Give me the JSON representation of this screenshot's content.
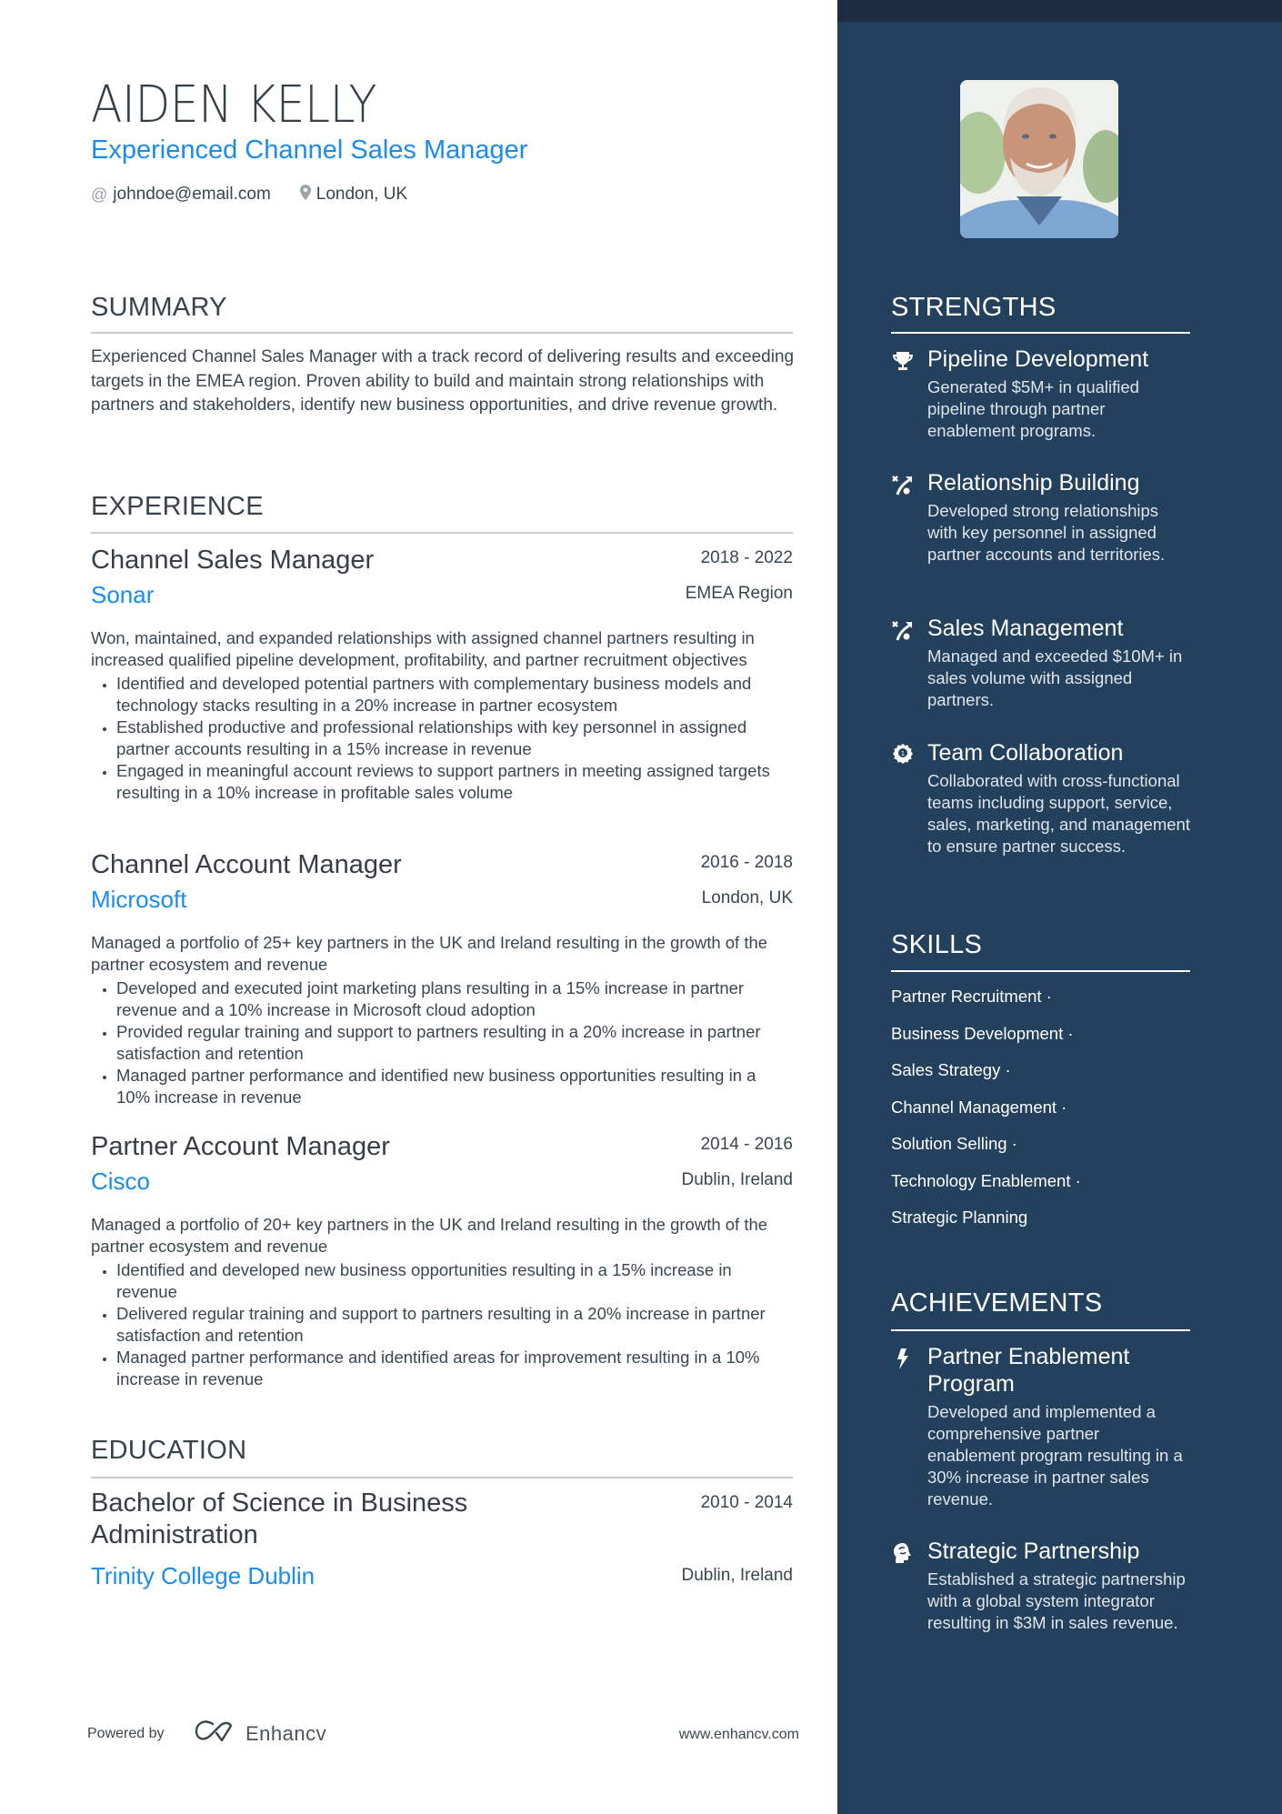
{
  "header": {
    "name": "AIDEN KELLY",
    "headline": "Experienced Channel Sales Manager",
    "email": "johndoe@email.com",
    "email_icon": "at-icon",
    "location": "London, UK",
    "location_icon": "map-pin-icon"
  },
  "summary": {
    "heading": "SUMMARY",
    "text": "Experienced Channel Sales Manager with a track record of delivering results and exceeding targets in the EMEA region. Proven ability to build and maintain strong relationships with partners and stakeholders, identify new business opportunities, and drive revenue growth."
  },
  "experience": {
    "heading": "EXPERIENCE",
    "jobs": [
      {
        "title": "Channel Sales Manager",
        "dates": "2018 - 2022",
        "company": "Sonar",
        "location": "EMEA Region",
        "description": "Won, maintained, and expanded relationships with assigned channel partners resulting in increased qualified pipeline development, profitability, and partner recruitment objectives",
        "bullets": [
          "Identified and developed potential partners with complementary business models and technology stacks resulting in a 20% increase in partner ecosystem",
          "Established productive and professional relationships with key personnel in assigned partner accounts resulting in a 15% increase in revenue",
          "Engaged in meaningful account reviews to support partners in meeting assigned targets resulting in a 10% increase in profitable sales volume"
        ]
      },
      {
        "title": "Channel Account Manager",
        "dates": "2016 - 2018",
        "company": "Microsoft",
        "location": "London, UK",
        "description": "Managed a portfolio of 25+ key partners in the UK and Ireland resulting in the growth of the partner ecosystem and revenue",
        "bullets": [
          "Developed and executed joint marketing plans resulting in a 15% increase in partner revenue and a 10% increase in Microsoft cloud adoption",
          "Provided regular training and support to partners resulting in a 20% increase in partner satisfaction and retention",
          "Managed partner performance and identified new business opportunities resulting in a 10% increase in revenue"
        ]
      },
      {
        "title": "Partner Account Manager",
        "dates": "2014 - 2016",
        "company": "Cisco",
        "location": "Dublin, Ireland",
        "description": "Managed a portfolio of 20+ key partners in the UK and Ireland resulting in the growth of the partner ecosystem and revenue",
        "bullets": [
          "Identified and developed new business opportunities resulting in a 15% increase in revenue",
          "Delivered regular training and support to partners resulting in a 20% increase in partner satisfaction and retention",
          "Managed partner performance and identified areas for improvement resulting in a 10% increase in revenue"
        ]
      }
    ]
  },
  "education": {
    "heading": "EDUCATION",
    "degree": "Bachelor of Science in Business Administration",
    "dates": "2010 - 2014",
    "school": "Trinity College Dublin",
    "location": "Dublin, Ireland"
  },
  "footer": {
    "powered_by": "Powered by",
    "brand": "Enhancv",
    "url": "www.enhancv.com"
  },
  "sidebar": {
    "photo_alt": "profile-photo",
    "strengths": {
      "heading": "STRENGTHS",
      "items": [
        {
          "icon": "trophy-icon",
          "title": "Pipeline Development",
          "text": "Generated $5M+ in qualified pipeline through partner enablement programs."
        },
        {
          "icon": "strategy-play-icon",
          "title": "Relationship Building",
          "text": "Developed strong relationships with key personnel in assigned partner accounts and territories."
        },
        {
          "icon": "strategy-play-icon",
          "title": "Sales Management",
          "text": "Managed and exceeded $10M+ in sales volume with assigned partners."
        },
        {
          "icon": "award-ribbon-icon",
          "title": "Team Collaboration",
          "text": "Collaborated with cross-functional teams including support, service, sales, marketing, and management to ensure partner success."
        }
      ]
    },
    "skills": {
      "heading": "SKILLS",
      "items": [
        "Partner Recruitment ·",
        "Business Development ·",
        "Sales Strategy ·",
        "Channel Management ·",
        "Solution Selling ·",
        "Technology Enablement ·",
        "Strategic Planning"
      ]
    },
    "achievements": {
      "heading": "ACHIEVEMENTS",
      "items": [
        {
          "icon": "lightning-bolt-icon",
          "title": "Partner Enablement Program",
          "text": "Developed and implemented a comprehensive partner enablement program resulting in a 30% increase in partner sales revenue."
        },
        {
          "icon": "head-brain-icon",
          "title": "Strategic Partnership",
          "text": "Established a strategic partnership with a global system integrator resulting in $3M in sales revenue."
        }
      ]
    }
  },
  "colors": {
    "accent": "#1a8cf0",
    "sidebar_bg": "#23405c",
    "sidebar_band": "#1b2d42",
    "text": "#3a464d"
  }
}
